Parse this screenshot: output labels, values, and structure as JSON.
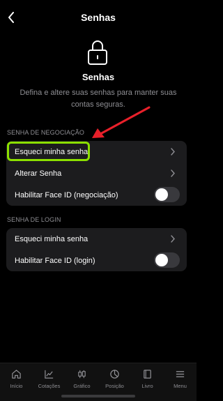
{
  "header": {
    "title": "Senhas"
  },
  "hero": {
    "title": "Senhas",
    "description": "Defina e altere suas senhas para manter suas contas seguras."
  },
  "sections": {
    "negotiation": {
      "label": "SENHA DE NEGOCIAÇÃO",
      "rows": [
        {
          "label": "Esqueci minha senha"
        },
        {
          "label": "Alterar Senha"
        },
        {
          "label": "Habilitar Face ID (negociação)",
          "toggle_on": false
        }
      ]
    },
    "login": {
      "label": "SENHA DE LOGIN",
      "rows": [
        {
          "label": "Esqueci minha senha"
        },
        {
          "label": "Habilitar Face ID (login)",
          "toggle_on": false
        }
      ]
    }
  },
  "tabbar": [
    {
      "label": "Início",
      "icon": "home-icon"
    },
    {
      "label": "Cotações",
      "icon": "chart-line-icon"
    },
    {
      "label": "Gráfico",
      "icon": "candlestick-icon"
    },
    {
      "label": "Posição",
      "icon": "pie-chart-icon"
    },
    {
      "label": "Livro",
      "icon": "book-icon"
    },
    {
      "label": "Menu",
      "icon": "menu-icon"
    }
  ],
  "colors": {
    "background": "#000000",
    "card": "#1c1c1e",
    "highlight": "#8ce000",
    "arrow": "#e8202a",
    "muted_text": "#8e8e93"
  }
}
